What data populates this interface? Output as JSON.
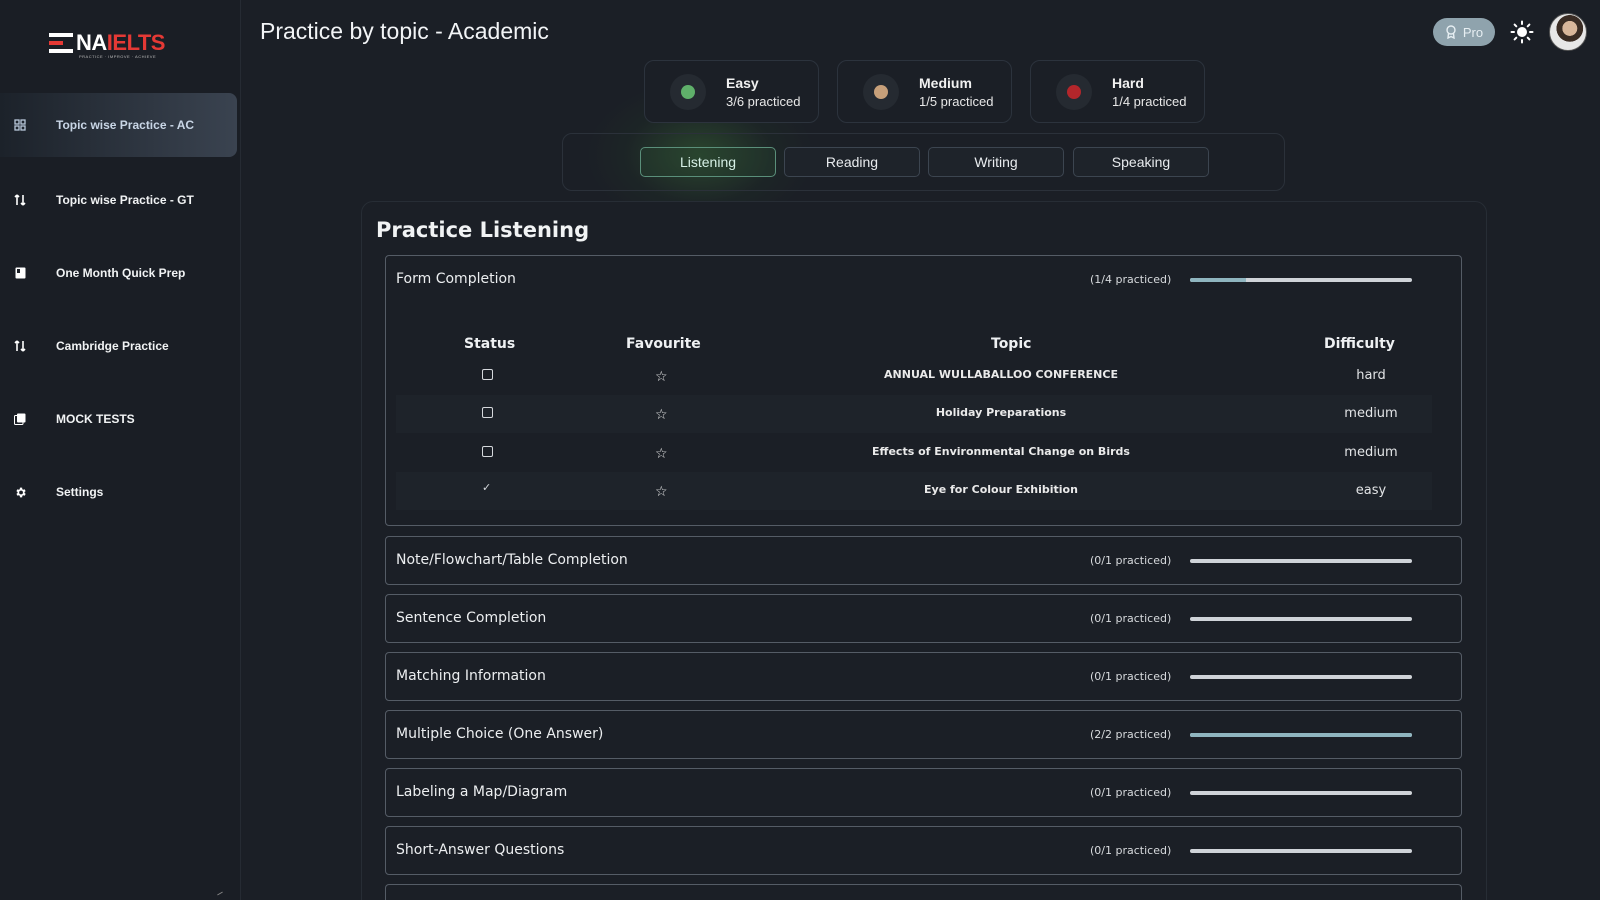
{
  "brand": {
    "logo_na": "NA",
    "logo_ielts": "IELTS",
    "logo_tagline": "PRACTICE · IMPROVE · ACHIEVE"
  },
  "sidebar": {
    "items": [
      {
        "label": "Topic wise Practice - AC",
        "icon": "grid-icon",
        "active": true
      },
      {
        "label": "Topic wise Practice - GT",
        "icon": "shuffle-icon",
        "active": false
      },
      {
        "label": "One Month Quick Prep",
        "icon": "book-icon",
        "active": false
      },
      {
        "label": "Cambridge Practice",
        "icon": "shuffle-icon",
        "active": false
      },
      {
        "label": "MOCK TESTS",
        "icon": "copy-icon",
        "active": false
      },
      {
        "label": "Settings",
        "icon": "gear-icon",
        "active": false
      }
    ]
  },
  "header": {
    "title": "Practice by topic - Academic",
    "pro_label": "Pro"
  },
  "difficulty_cards": [
    {
      "name": "Easy",
      "count": "3/6 practiced",
      "color": "#5fb06a"
    },
    {
      "name": "Medium",
      "count": "1/5 practiced",
      "color": "#c7a07a"
    },
    {
      "name": "Hard",
      "count": "1/4 practiced",
      "color": "#b3262b"
    }
  ],
  "tabs": [
    {
      "label": "Listening",
      "active": true
    },
    {
      "label": "Reading",
      "active": false
    },
    {
      "label": "Writing",
      "active": false
    },
    {
      "label": "Speaking",
      "active": false
    }
  ],
  "panel": {
    "title": "Practice Listening",
    "table_headers": {
      "status": "Status",
      "favourite": "Favourite",
      "topic": "Topic",
      "difficulty": "Difficulty"
    },
    "sections": [
      {
        "title": "Form Completion",
        "count": "(1/4 practiced)",
        "progress": 0.25,
        "expanded": true,
        "rows": [
          {
            "done": false,
            "topic": "ANNUAL WULLABALLOO CONFERENCE",
            "difficulty": "hard"
          },
          {
            "done": false,
            "topic": "Holiday Preparations",
            "difficulty": "medium"
          },
          {
            "done": false,
            "topic": "Effects of Environmental Change on Birds",
            "difficulty": "medium"
          },
          {
            "done": true,
            "topic": "Eye for Colour Exhibition",
            "difficulty": "easy"
          }
        ]
      },
      {
        "title": "Note/Flowchart/Table Completion",
        "count": "(0/1 practiced)",
        "progress": 0
      },
      {
        "title": "Sentence Completion",
        "count": "(0/1 practiced)",
        "progress": 0
      },
      {
        "title": "Matching Information",
        "count": "(0/1 practiced)",
        "progress": 0
      },
      {
        "title": "Multiple Choice (One Answer)",
        "count": "(2/2 practiced)",
        "progress": 1
      },
      {
        "title": "Labeling a Map/Diagram",
        "count": "(0/1 practiced)",
        "progress": 0
      },
      {
        "title": "Short-Answer Questions",
        "count": "(0/1 practiced)",
        "progress": 0
      }
    ]
  },
  "colors": {
    "progress_fill": "#8fb5bf",
    "progress_track": "#cfd3d8",
    "accent_tab": "#5a8f7a"
  }
}
